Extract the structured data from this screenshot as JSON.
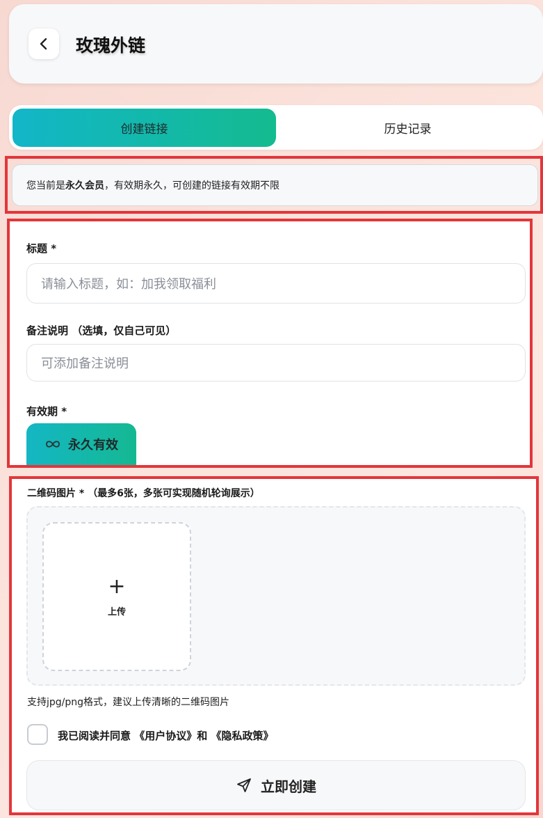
{
  "header": {
    "title": "玫瑰外链"
  },
  "tabs": [
    {
      "label": "创建链接",
      "active": true
    },
    {
      "label": "历史记录",
      "active": false
    }
  ],
  "notice": {
    "prefix": "您当前是",
    "highlight": "永久会员",
    "suffix": "，有效期永久，可创建的链接有效期不限"
  },
  "form": {
    "title_label": "标题 *",
    "title_placeholder": "请输入标题，如：加我领取福利",
    "note_label": "备注说明 （选填，仅自己可见）",
    "note_placeholder": "可添加备注说明",
    "validity_label": "有效期 *",
    "validity_option": "永久有效"
  },
  "qr": {
    "label": "二维码图片 * （最多6张，多张可实现随机轮询展示）",
    "upload_label": "上传",
    "hint": "支持jpg/png格式，建议上传清晰的二维码图片",
    "agree_text": "我已阅读并同意 《用户协议》和 《隐私政策》",
    "agree_checked": false,
    "create_button": "立即创建"
  },
  "colors": {
    "accent_start": "#12b6c8",
    "accent_end": "#14bb8f",
    "highlight_border": "#e2363b"
  }
}
